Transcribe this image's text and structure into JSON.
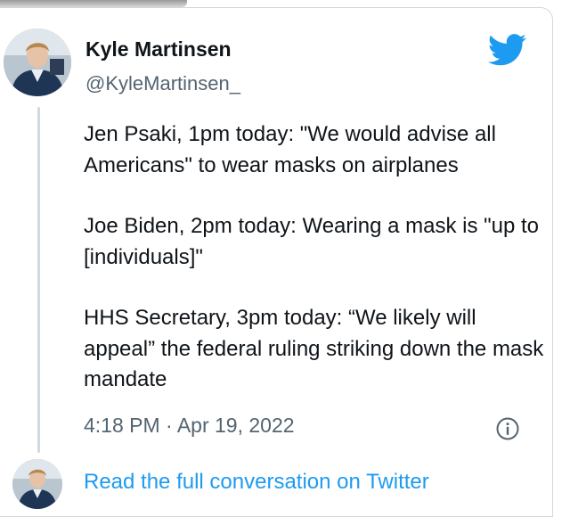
{
  "author": {
    "name": "Kyle Martinsen",
    "handle": "@KyleMartinsen_"
  },
  "tweet": {
    "paragraphs": [
      "Jen Psaki, 1pm today: \"We would advise all Americans\" to wear masks on airplanes",
      "Joe Biden, 2pm today: Wearing a mask is \"up to [individuals]\"",
      "HHS Secretary, 3pm today: “We likely will appeal” the federal ruling striking down the mask mandate"
    ],
    "timestamp": "4:18 PM · Apr 19, 2022"
  },
  "footer": {
    "read_more": "Read the full conversation on Twitter"
  },
  "icons": {
    "brand": "twitter-bird-icon",
    "info": "info-icon"
  },
  "colors": {
    "accent": "#1d9bf0",
    "muted": "#536471",
    "text": "#0f1419"
  }
}
